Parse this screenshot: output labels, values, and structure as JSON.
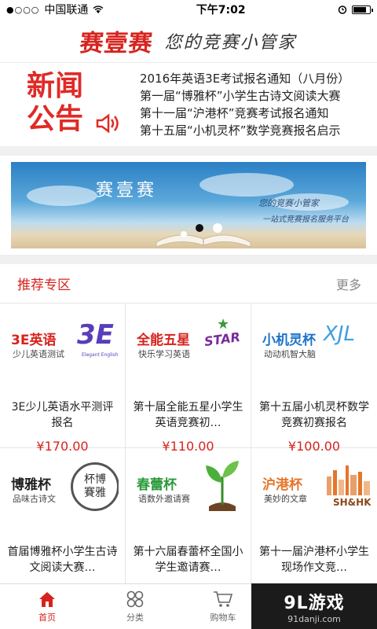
{
  "status": {
    "carrier": "中国联通",
    "time": "下午7:02"
  },
  "header": {
    "logo": "赛壹赛",
    "slogan": "您的竞赛小管家"
  },
  "news": {
    "badge_line1": "新闻",
    "badge_line2": "公告",
    "items": [
      "2016年英语3E考试报名通知（八月份）",
      "第一届“博雅杯”小学生古诗文阅读大赛",
      "第十一届“沪港杯”竞赛考试报名通知",
      "第十五届“小机灵杯”数学竞赛报名启示"
    ]
  },
  "banner": {
    "title": "赛壹赛",
    "sub1": "您的竞赛小管家",
    "sub2": "一站式竞赛报名服务平台"
  },
  "section": {
    "title": "推荐专区",
    "more": "更多"
  },
  "cards": [
    {
      "brand": "3E英语",
      "brand_sub": "少儿英语测试",
      "mark": "3E",
      "mark_sub": "Elegant English",
      "name": "3E少儿英语水平测评报名",
      "price": "¥170.00",
      "color": "#d7231e"
    },
    {
      "brand": "全能五星",
      "brand_sub": "快乐学习英语",
      "mark": "STAR",
      "name": "第十届全能五星小学生英语竞赛初…",
      "price": "¥110.00",
      "color": "#d7231e"
    },
    {
      "brand": "小机灵杯",
      "brand_sub": "动动机智大脑",
      "mark": "XJL",
      "name": "第十五届小机灵杯数学竞赛初赛报名",
      "price": "¥100.00",
      "color": "#1d73c9"
    },
    {
      "brand": "博雅杯",
      "brand_sub": "品味古诗文",
      "mark": "杯博 賽雅",
      "name": "首届博雅杯小学生古诗文阅读大赛…",
      "price": "",
      "color": "#222222"
    },
    {
      "brand": "春蕾杯",
      "brand_sub": "语数外邀请赛",
      "mark": "",
      "name": "第十六届春蕾杯全国小学生邀请赛…",
      "price": "",
      "color": "#2a9a3a"
    },
    {
      "brand": "沪港杯",
      "brand_sub": "美妙的文章",
      "mark": "SH&HK",
      "name": "第十一届沪港杯小学生现场作文竞…",
      "price": "",
      "color": "#e5762a"
    }
  ],
  "tabs": [
    {
      "label": "首页",
      "icon": "home-icon",
      "active": true
    },
    {
      "label": "分类",
      "icon": "category-icon",
      "active": false
    },
    {
      "label": "购物车",
      "icon": "cart-icon",
      "active": false
    }
  ],
  "watermark": {
    "main": "9L游戏",
    "sub": "91danji.com"
  }
}
